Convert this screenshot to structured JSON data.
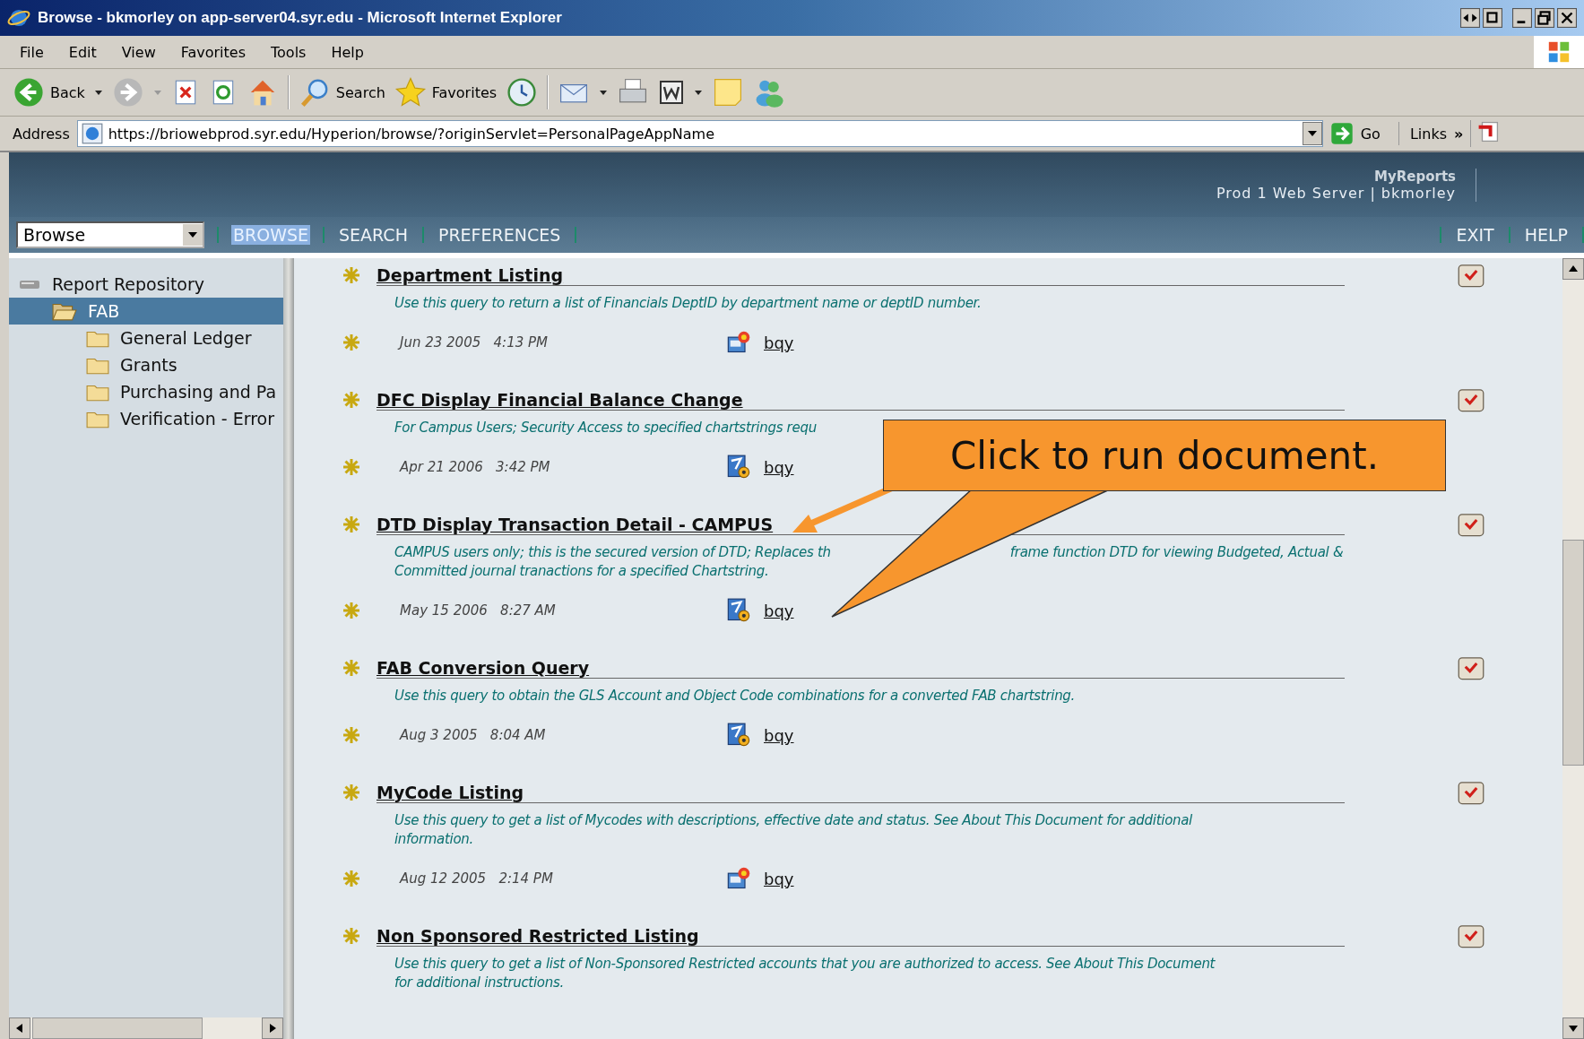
{
  "window": {
    "title": "Browse - bkmorley on app-server04.syr.edu - Microsoft Internet Explorer"
  },
  "menu": [
    "File",
    "Edit",
    "View",
    "Favorites",
    "Tools",
    "Help"
  ],
  "toolbar": [
    {
      "kind": "back",
      "label": "Back"
    },
    {
      "kind": "forward"
    },
    {
      "kind": "stop"
    },
    {
      "kind": "refresh"
    },
    {
      "kind": "home"
    },
    {
      "kind": "search",
      "label": "Search"
    },
    {
      "kind": "favorites",
      "label": "Favorites"
    },
    {
      "kind": "history"
    },
    {
      "kind": "mail"
    },
    {
      "kind": "print"
    },
    {
      "kind": "word"
    },
    {
      "kind": "note"
    },
    {
      "kind": "messenger"
    }
  ],
  "address": {
    "label": "Address",
    "value": "https://briowebprod.syr.edu/Hyperion/browse/?originServlet=PersonalPageAppName",
    "go": "Go",
    "links": "Links",
    "chevron": "»"
  },
  "header": {
    "app": "MyReports",
    "server": "Prod 1 Web Server | bkmorley"
  },
  "nav": {
    "dropdown": "Browse",
    "tabs": [
      {
        "label": "BROWSE",
        "selected": true
      },
      {
        "label": "SEARCH",
        "selected": false
      },
      {
        "label": "PREFERENCES",
        "selected": false
      }
    ],
    "right": [
      "EXIT",
      "HELP"
    ]
  },
  "tree": [
    {
      "label": "Report Repository",
      "kind": "drive",
      "selected": false,
      "children": [
        {
          "label": "FAB",
          "kind": "open-folder",
          "selected": true,
          "children": [
            {
              "label": "General Ledger",
              "kind": "folder",
              "selected": false
            },
            {
              "label": "Grants",
              "kind": "folder",
              "selected": false
            },
            {
              "label": "Purchasing and Pa",
              "kind": "folder",
              "selected": false
            },
            {
              "label": "Verification - Error",
              "kind": "folder",
              "selected": false
            }
          ]
        }
      ]
    }
  ],
  "documents": [
    {
      "title": "Department Listing",
      "description": [
        [
          "Use this query to return a list of Financials DeptID by department name or deptID number."
        ]
      ],
      "date": "Jun 23 2005   4:13 PM",
      "kind": "burst",
      "file": "bqy"
    },
    {
      "title": "DFC Display Financial Balance Change",
      "description": [
        [
          "For Campus Users; Security Access to specified chartstrings requ"
        ]
      ],
      "date": "Apr 21 2006   3:42 PM",
      "kind": "gear",
      "file": "bqy"
    },
    {
      "title": "DTD Display Transaction Detail - CAMPUS",
      "description": [
        [
          "CAMPUS users only; this is the secured version of DTD; Replaces th",
          "frame function DTD for viewing Budgeted, Actual &"
        ],
        [
          "Committed journal tranactions for a specified Chartstring."
        ]
      ],
      "date": "May 15 2006   8:27 AM",
      "kind": "gear",
      "file": "bqy"
    },
    {
      "title": "FAB Conversion Query",
      "description": [
        [
          "Use this query to obtain the GLS Account and Object Code combinations for a converted FAB chartstring."
        ]
      ],
      "date": "Aug 3 2005   8:04 AM",
      "kind": "gear",
      "file": "bqy"
    },
    {
      "title": "MyCode Listing",
      "description": [
        [
          "Use this query to get a list of Mycodes with descriptions, effective date and status. See About This Document for additional"
        ],
        [
          "information."
        ]
      ],
      "date": "Aug 12 2005   2:14 PM",
      "kind": "burst",
      "file": "bqy"
    },
    {
      "title": "Non Sponsored Restricted Listing",
      "description": [
        [
          "Use this query to get a list of Non-Sponsored Restricted accounts that you are authorized to access. See About This Document"
        ],
        [
          "for additional instructions."
        ]
      ]
    }
  ],
  "callout": {
    "text": "Click to run document."
  }
}
